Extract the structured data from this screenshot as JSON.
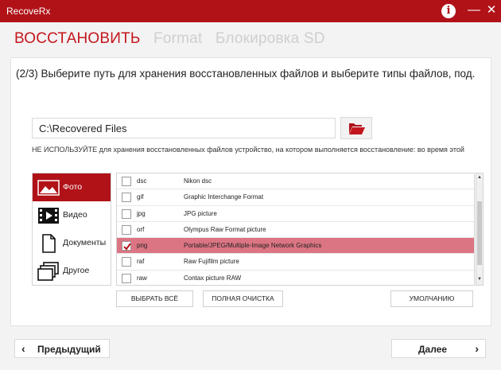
{
  "window": {
    "title": "RecoveRx",
    "info_icon": "info-icon",
    "minimize_glyph": "—",
    "close_glyph": "✕"
  },
  "tabs": [
    {
      "label": "ВОССТАНОВИТЬ",
      "active": true
    },
    {
      "label": "Format",
      "active": false
    },
    {
      "label": "Блокировка SD",
      "active": false
    }
  ],
  "step_text": "(2/3) Выберите путь для хранения восстановленных файлов и выберите типы файлов, под.",
  "path": {
    "value": "C:\\Recovered Files"
  },
  "warning": "НЕ ИСПОЛЬЗУЙТЕ для хранения восстановленных файлов устройство, на котором выполняется восстановление: во время этой",
  "categories": [
    {
      "label": "Фото",
      "icon": "photo-icon",
      "selected": true
    },
    {
      "label": "Видео",
      "icon": "video-icon",
      "selected": false
    },
    {
      "label": "Документы",
      "icon": "document-icon",
      "selected": false
    },
    {
      "label": "Другое",
      "icon": "other-icon",
      "selected": false
    }
  ],
  "file_types": [
    {
      "ext": "dsc",
      "desc": "Nikon dsc",
      "checked": false,
      "selected": false
    },
    {
      "ext": "gif",
      "desc": "Graphic Interchange Format",
      "checked": false,
      "selected": false
    },
    {
      "ext": "jpg",
      "desc": "JPG picture",
      "checked": false,
      "selected": false
    },
    {
      "ext": "orf",
      "desc": "Olympus Raw Format picture",
      "checked": false,
      "selected": false
    },
    {
      "ext": "png",
      "desc": "Portable/JPEG/Multiple-Image Network Graphics",
      "checked": true,
      "selected": true
    },
    {
      "ext": "raf",
      "desc": "Raw Fujifilm picture",
      "checked": false,
      "selected": false
    },
    {
      "ext": "raw",
      "desc": "Contax picture RAW",
      "checked": false,
      "selected": false
    }
  ],
  "buttons": {
    "select_all": "ВЫБРАТЬ ВСЁ",
    "clear_all": "ПОЛНАЯ ОЧИСТКА",
    "default": "УМОЛЧАНИЮ",
    "prev": "Предыдущий",
    "next": "Далее"
  },
  "colors": {
    "brand_red": "#b01218",
    "active_tab": "#c4161e",
    "selected_row": "#dc7583"
  }
}
